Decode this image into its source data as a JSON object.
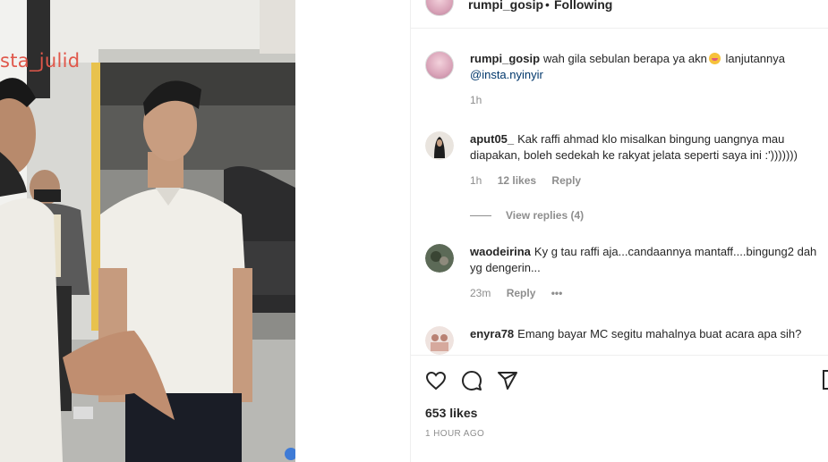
{
  "media": {
    "watermark": "sta_julid"
  },
  "post_header": {
    "username": "rumpi_gosip",
    "separator": "•",
    "follow_status": "Following",
    "more_icon": "•••"
  },
  "caption": {
    "username": "rumpi_gosip",
    "text_before_emoji": "wah gila sebulan berapa ya akn",
    "emoji": "face-emoji",
    "text_after_emoji": "lanjutannya",
    "mention": "@insta.nyinyir",
    "time": "1h"
  },
  "comments": [
    {
      "username": "aput05_",
      "text": "Kak raffi ahmad klo misalkan bingung uangnya mau diapakan, boleh sedekah ke rakyat jelata seperti saya ini :')))))))",
      "time": "1h",
      "likes": "12 likes",
      "reply": "Reply",
      "view_replies": "View replies (4)"
    },
    {
      "username": "waodeirina",
      "text": "Ky g tau raffi aja...candaannya mantaff....bingung2 dah yg dengerin...",
      "time": "23m",
      "reply": "Reply",
      "more": "•••"
    },
    {
      "username": "enyra78",
      "text": "Emang bayar MC segitu mahalnya buat acara apa sih?"
    }
  ],
  "actions": {
    "like_icon": "heart-icon",
    "comment_icon": "comment-icon",
    "share_icon": "send-icon",
    "save_icon": "bookmark-icon"
  },
  "stats": {
    "likes": "653 likes",
    "posted": "1 HOUR AGO"
  },
  "colors": {
    "text": "#262626",
    "muted": "#8e8e8e",
    "mention": "#00376b",
    "border": "#efefef"
  }
}
